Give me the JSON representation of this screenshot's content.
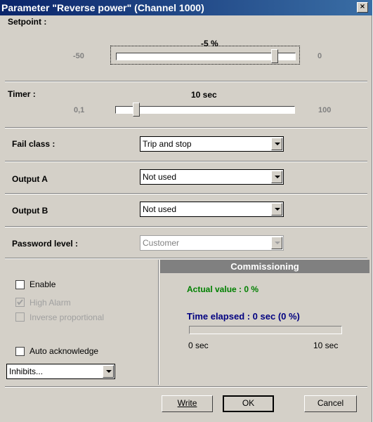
{
  "window": {
    "title": "Parameter \"Reverse power\" (Channel 1000)",
    "close_glyph": "×"
  },
  "setpoint": {
    "label": "Setpoint :",
    "value_text": "-5 %",
    "min": "-50",
    "max": "0",
    "value": -5
  },
  "timer": {
    "label": "Timer :",
    "value_text": "10 sec",
    "min": "0,1",
    "max": "100",
    "value": 10
  },
  "fail_class": {
    "label": "Fail class :",
    "value": "Trip and stop"
  },
  "output_a": {
    "label": "Output A",
    "value": "Not used"
  },
  "output_b": {
    "label": "Output B",
    "value": "Not used"
  },
  "password_level": {
    "label": "Password level :",
    "value": "Customer"
  },
  "options": {
    "enable": {
      "label": "Enable",
      "checked": false
    },
    "high_alarm": {
      "label": "High Alarm",
      "checked": true,
      "disabled": true
    },
    "inverse_proportional": {
      "label": "Inverse proportional",
      "checked": false,
      "disabled": true
    },
    "auto_acknowledge": {
      "label": "Auto acknowledge",
      "checked": false
    },
    "inhibits": {
      "value": "Inhibits..."
    }
  },
  "commissioning": {
    "header": "Commissioning",
    "actual_value": "Actual value : 0 %",
    "time_elapsed": "Time elapsed : 0 sec (0 %)",
    "progress_start": "0 sec",
    "progress_end": "10 sec",
    "progress_fraction": 0
  },
  "buttons": {
    "write": "Write",
    "ok": "OK",
    "cancel": "Cancel"
  },
  "colors": {
    "title_gradient_start": "#0a246a",
    "title_gradient_end": "#3a6ea5",
    "actual_value": "#008000",
    "time_elapsed": "#000080",
    "dialog_face": "#d4d0c8"
  }
}
